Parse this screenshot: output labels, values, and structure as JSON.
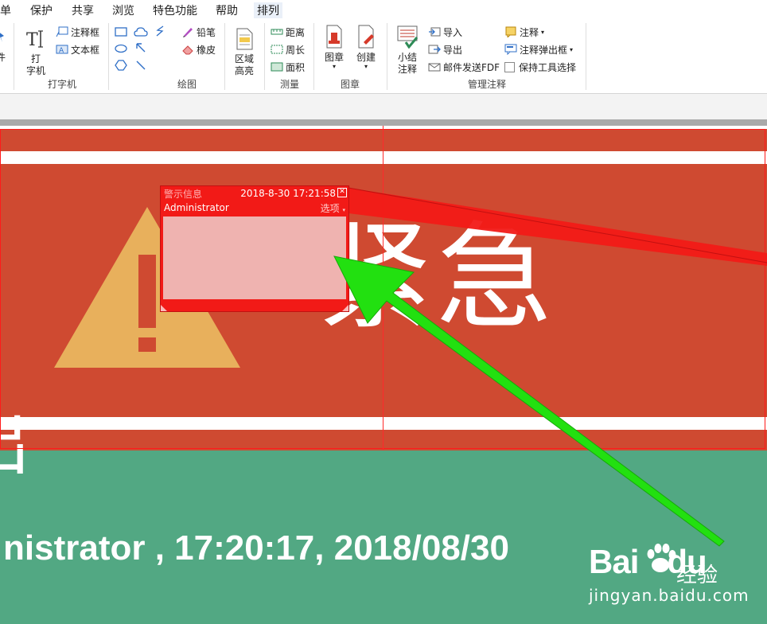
{
  "menu": {
    "items": [
      "单",
      "保护",
      "共享",
      "浏览",
      "特色功能",
      "帮助",
      "排列"
    ]
  },
  "ribbon": {
    "left_partial_label": "件",
    "typewriter": {
      "group_label": "打字机",
      "typewriter_label_1": "打",
      "typewriter_label_2": "字机",
      "callout_label": "注释框",
      "textbox_label": "文本框"
    },
    "drawing": {
      "group_label": "绘图",
      "pencil_label": "铅笔",
      "eraser_label": "橡皮",
      "area_highlight_label_1": "区域",
      "area_highlight_label_2": "高亮"
    },
    "measure": {
      "group_label": "测量",
      "distance_label": "距离",
      "perimeter_label": "周长",
      "area_label": "面积"
    },
    "stamp": {
      "group_label": "图章",
      "stamp_label": "图章",
      "create_label": "创建"
    },
    "manage": {
      "group_label": "管理注释",
      "summary_label_1": "小结",
      "summary_label_2": "注释",
      "import_label": "导入",
      "export_label": "导出",
      "email_label": "邮件发送FDF",
      "annotation_label": "注释",
      "popup_label": "注释弹出框",
      "keep_tool_label": "保持工具选择"
    }
  },
  "document": {
    "urgent_text": "紧急",
    "partial_char": "出",
    "stamp_line": "nistrator , 17:20:17, 2018/08/30",
    "colors": {
      "banner": "#cf4a31",
      "green": "#52a883",
      "warning_triangle": "#e8b05c",
      "arrow": "#22e010"
    }
  },
  "popup": {
    "title": "警示信息",
    "date": "2018-8-30 17:21:58",
    "author": "Administrator",
    "options": "选项",
    "body": ""
  },
  "watermark": {
    "logo": "Bai",
    "logo_suffix": "du",
    "jingyan": "经验",
    "url": "jingyan.baidu.com"
  }
}
